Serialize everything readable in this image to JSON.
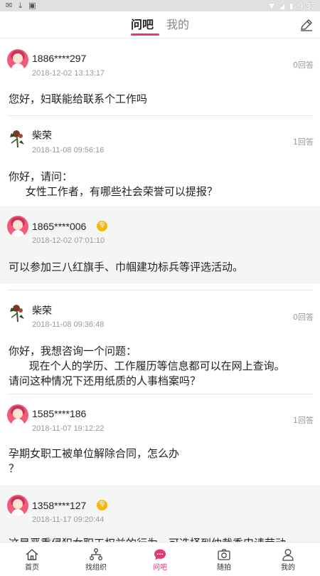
{
  "status_bar": {
    "time": "9:37"
  },
  "header": {
    "tabs": [
      {
        "label": "问吧",
        "active": true
      },
      {
        "label": "我的",
        "active": false
      }
    ]
  },
  "feed": [
    {
      "kind": "question",
      "user": "1886****297",
      "time": "2018-12-02 13:13:17",
      "answers": "0回答",
      "lines": [
        "您好，妇联能给联系个工作吗"
      ]
    },
    {
      "kind": "question",
      "user": "柴荣",
      "time": "2018-11-08 09:56:16",
      "answers": "1回答",
      "lines": [
        "你好，请问：",
        "     女性工作者，有哪些社会荣誉可以提报？"
      ]
    },
    {
      "kind": "reply",
      "user": "1865****006",
      "time": "2018-12-02 07:01:10",
      "badge": "专",
      "lines": [
        "可以参加三八红旗手、巾帼建功标兵等评选活动。"
      ]
    },
    {
      "kind": "question",
      "user": "柴荣",
      "time": "2018-11-08 09:36:48",
      "answers": "0回答",
      "lines": [
        "你好，我想咨询一个问题：",
        "      现在个人的学历、工作履历等信息都可以在网上查询。",
        "请问这种情况下还用纸质的人事档案吗？"
      ]
    },
    {
      "kind": "question",
      "user": "1585****186",
      "time": "2018-11-07 19:12:22",
      "answers": "1回答",
      "lines": [
        "孕期女职工被单位解除合同，怎么办",
        "？"
      ]
    },
    {
      "kind": "reply",
      "user": "1358****127",
      "time": "2018-11-17 09:20:44",
      "badge": "专",
      "lines": [
        "这是严重侵犯女职工权益的行为，可选择到仲裁委申请劳动"
      ]
    }
  ],
  "bottom_nav": [
    {
      "label": "首页",
      "icon": "home-icon",
      "active": false
    },
    {
      "label": "找组织",
      "icon": "organization-icon",
      "active": false
    },
    {
      "label": "问吧",
      "icon": "chat-bubble-icon",
      "active": true
    },
    {
      "label": "随拍",
      "icon": "camera-icon",
      "active": false
    },
    {
      "label": "我的",
      "icon": "user-icon",
      "active": false
    }
  ],
  "colors": {
    "accent": "#e23a6c",
    "badge": "#f5b800",
    "avatar_pink": "#f25a7a",
    "reply_bg": "#f5f5f5"
  }
}
